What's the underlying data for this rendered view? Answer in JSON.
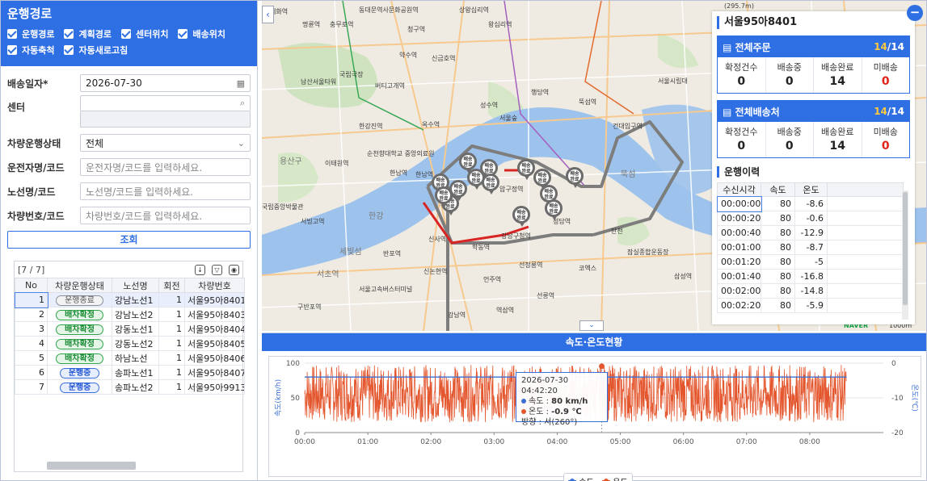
{
  "left": {
    "title": "운행경로",
    "checks": [
      "운행경로",
      "계획경로",
      "센터위치",
      "배송위치",
      "자동축척",
      "자동새로고침"
    ],
    "form": {
      "date_label": "배송일자*",
      "date_value": "2026-07-30",
      "center_label": "센터",
      "status_label": "차량운행상태",
      "status_value": "전체",
      "driver_label": "운전자명/코드",
      "driver_placeholder": "운전자명/코드를 입력하세요.",
      "route_label": "노선명/코드",
      "route_placeholder": "노선명/코드를 입력하세요.",
      "car_label": "차량번호/코드",
      "car_placeholder": "차량번호/코드를 입력하세요."
    },
    "search_label": "조회",
    "grid": {
      "count": "[7 / 7]",
      "headers": [
        "No",
        "차량운행상태",
        "노선명",
        "회전",
        "차량번호"
      ],
      "rows": [
        {
          "no": "1",
          "status": "운행종료",
          "kind": "end",
          "route": "강남노선1",
          "turn": "1",
          "car": "서울95아8401"
        },
        {
          "no": "2",
          "status": "배차확정",
          "kind": "assign",
          "route": "강남노선2",
          "turn": "1",
          "car": "서울95아8403"
        },
        {
          "no": "3",
          "status": "배차확정",
          "kind": "assign",
          "route": "강동노선1",
          "turn": "1",
          "car": "서울95아8404"
        },
        {
          "no": "4",
          "status": "배차확정",
          "kind": "assign",
          "route": "강동노선2",
          "turn": "1",
          "car": "서울95아8405"
        },
        {
          "no": "5",
          "status": "배차확정",
          "kind": "assign",
          "route": "하남노선",
          "turn": "1",
          "car": "서울95아8406"
        },
        {
          "no": "6",
          "status": "운행중",
          "kind": "run",
          "route": "송파노선1",
          "turn": "1",
          "car": "서울95아8407"
        },
        {
          "no": "7",
          "status": "운행중",
          "kind": "run",
          "route": "송파노선2",
          "turn": "1",
          "car": "서울95아9913"
        }
      ]
    }
  },
  "map": {
    "labels": [
      "명륜역",
      "동대문역사문화공원역",
      "상왕십리역",
      "혜화역",
      "충무로역",
      "청구역",
      "왕십리역",
      "신금호역",
      "약수역",
      "행당역",
      "버티고개역",
      "남산서울타워",
      "국립극장",
      "한남역",
      "옥수역",
      "한강진역",
      "서울숲",
      "뚝섬역",
      "건대입구역",
      "용산구",
      "순천향대학교 중앙의료원",
      "이태원역",
      "한남역",
      "압구정역",
      "국립중앙박물관",
      "서빙고역",
      "반포역",
      "서초역",
      "세빛섬",
      "신사역",
      "학동역",
      "강남구청역",
      "선정릉역",
      "서울고속버스터미널",
      "신논현역",
      "언주역",
      "선릉역",
      "역삼역",
      "강남역",
      "구반포역",
      "코엑스",
      "잠실종합운동장",
      "청담역",
      "서울시립대",
      "탄천",
      "한강",
      "뚝섬",
      "성수역",
      "삼성역"
    ],
    "pins": [
      "배송완료",
      "배송완료",
      "배송완료",
      "배송완료",
      "배송완료",
      "배송완료",
      "배송완료",
      "배송완료",
      "배송완료",
      "배송완료",
      "배송완료",
      "배송완료",
      "배송완료",
      "배송완료"
    ],
    "scale": "1000m",
    "top_note": "(295.7m)",
    "brand": "NAVER"
  },
  "info": {
    "vehicle": "서울95아8401",
    "orders": {
      "title": "전체주문",
      "done": "14",
      "total": "14",
      "labels": [
        "확정건수",
        "배송중",
        "배송완료",
        "미배송"
      ],
      "values": [
        "0",
        "0",
        "14",
        "0"
      ]
    },
    "places": {
      "title": "전체배송처",
      "done": "14",
      "total": "14",
      "labels": [
        "확정건수",
        "배송중",
        "배송완료",
        "미배송"
      ],
      "values": [
        "0",
        "0",
        "14",
        "0"
      ]
    },
    "history_title": "운행이력",
    "history_headers": [
      "수신시각",
      "속도",
      "온도"
    ],
    "history": [
      [
        "00:00:00",
        "80",
        "-8.6"
      ],
      [
        "00:00:20",
        "80",
        "-0.6"
      ],
      [
        "00:00:40",
        "80",
        "-12.9"
      ],
      [
        "00:01:00",
        "80",
        "-8.7"
      ],
      [
        "00:01:20",
        "80",
        "-5"
      ],
      [
        "00:01:40",
        "80",
        "-16.8"
      ],
      [
        "00:02:00",
        "80",
        "-14.8"
      ],
      [
        "00:02:20",
        "80",
        "-5.9"
      ]
    ]
  },
  "chart_title": "속도·온도현황",
  "chart_data": {
    "type": "line",
    "x": [
      "00:00",
      "01:00",
      "02:00",
      "03:00",
      "04:00",
      "05:00",
      "06:00",
      "07:00",
      "08:00"
    ],
    "xlim": [
      "00:00",
      "09:10"
    ],
    "series": [
      {
        "name": "속도",
        "axis": "left",
        "color": "#3b6fd4",
        "constant_value": 80
      },
      {
        "name": "온도",
        "axis": "right",
        "color": "#e4572e",
        "range": [
          -17,
          -0.5
        ]
      }
    ],
    "ylabel": "속도(km/h)",
    "y2label": "온도(℃)",
    "ylim": [
      0,
      100
    ],
    "y2lim": [
      -20,
      0
    ],
    "yticks": [
      "100",
      "50",
      "0"
    ],
    "y2ticks": [
      "0",
      "-10",
      "-20"
    ],
    "tooltip": {
      "time": "2026-07-30 04:42:20",
      "speed_label": "속도",
      "speed": "80 km/h",
      "temp_label": "온도",
      "temp": "-0.9 ℃",
      "dir": "방향 : 서(260°)"
    }
  }
}
